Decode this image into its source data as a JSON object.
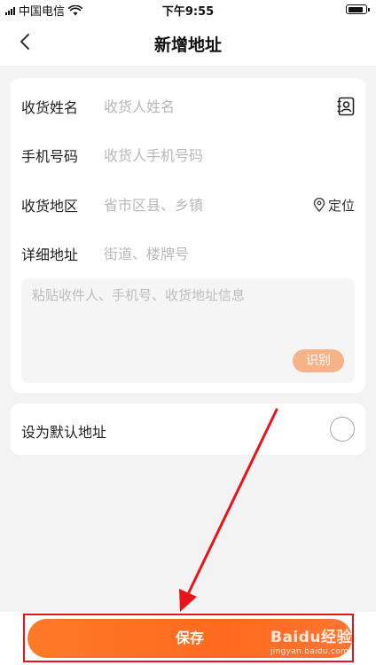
{
  "status_bar": {
    "carrier": "中国电信",
    "time": "下午9:55"
  },
  "nav": {
    "title": "新增地址"
  },
  "form": {
    "name": {
      "label": "收货姓名",
      "placeholder": "收货人姓名"
    },
    "phone": {
      "label": "手机号码",
      "placeholder": "收货人手机号码"
    },
    "region": {
      "label": "收货地区",
      "placeholder": "省市区县、乡镇",
      "locate_label": "定位"
    },
    "detail": {
      "label": "详细地址",
      "placeholder": "街道、楼牌号"
    },
    "paste": {
      "placeholder": "粘贴收件人、手机号、收货地址信息",
      "recognize_label": "识别"
    }
  },
  "default_address": {
    "label": "设为默认地址"
  },
  "footer": {
    "save_label": "保存"
  },
  "watermark": {
    "brand": "Baidu经验",
    "url": "jingyan.baidu.com"
  },
  "colors": {
    "accent": "#ff6f22",
    "recognize_bg": "#f6b38a",
    "annotation_red": "#e8141a"
  }
}
